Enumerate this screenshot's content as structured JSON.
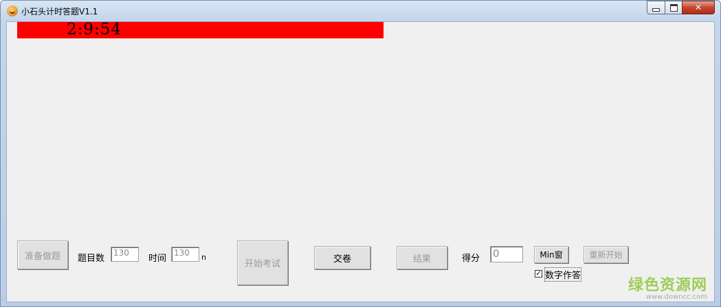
{
  "window": {
    "title": "小石头计时答题V1.1",
    "controls": {
      "minimize": "minimize",
      "maximize": "maximize",
      "close": "close"
    }
  },
  "timer": {
    "display": "2:9:54",
    "bar_color": "#ff0000"
  },
  "controls": {
    "prepare_button": "准备做题",
    "question_count_label": "题目数",
    "question_count_value": "130",
    "time_label": "时间",
    "time_value": "130",
    "time_unit": "n",
    "start_button": "开始考试",
    "submit_button": "交卷",
    "result_button": "结果",
    "score_label": "得分",
    "score_value": "0",
    "min_window_button": "Min窗",
    "restart_button": "重新开始",
    "digit_answer_label": "数字作答",
    "digit_answer_checked": true
  },
  "watermark": {
    "main": "绿色资源网",
    "sub": "www.downcc.com"
  }
}
